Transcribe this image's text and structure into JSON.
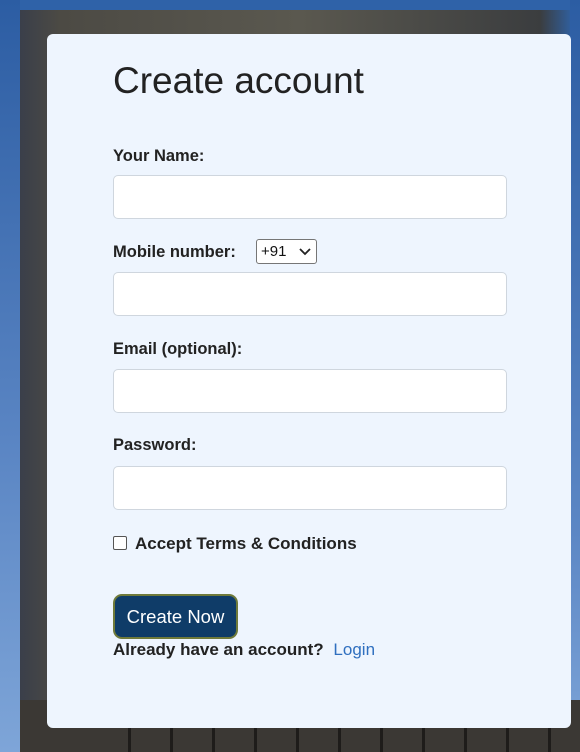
{
  "form": {
    "title": "Create account",
    "name_label": "Your Name:",
    "name_value": "",
    "mobile_label": "Mobile number:",
    "country_code": "+91",
    "mobile_value": "",
    "email_label": "Email (optional):",
    "email_value": "",
    "password_label": "Password:",
    "password_value": "",
    "terms_label": "Accept Terms & Conditions",
    "terms_checked": false,
    "submit_label": "Create Now",
    "login_prompt": "Already have an account?",
    "login_link": "Login"
  },
  "colors": {
    "card_bg": "#eef5fe",
    "button_bg": "#0f3c68",
    "link": "#2f6fbf"
  }
}
